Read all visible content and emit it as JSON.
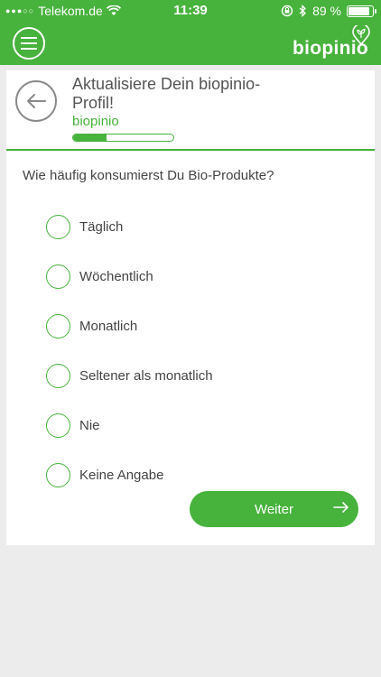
{
  "status_bar": {
    "carrier": "Telekom.de",
    "time": "11:39",
    "battery_percent": "89 %",
    "battery_level": 0.89
  },
  "header": {
    "brand": "biopinio"
  },
  "profile": {
    "title": "Aktualisiere Dein biopinio-Profil!",
    "subtitle": "biopinio",
    "progress": 0.33
  },
  "survey": {
    "question": "Wie häufig konsumierst Du Bio-Produkte?",
    "options": [
      "Täglich",
      "Wöchentlich",
      "Monatlich",
      "Seltener als monatlich",
      "Nie",
      "Keine Angabe"
    ]
  },
  "next_button": {
    "label": "Weiter"
  },
  "colors": {
    "accent": "#47b23c",
    "background": "#ececec"
  },
  "icons": [
    "menu-icon",
    "leaf-icon",
    "back-arrow-icon",
    "wifi-icon",
    "bluetooth-icon",
    "lock-rotation-icon",
    "arrow-right-icon"
  ]
}
